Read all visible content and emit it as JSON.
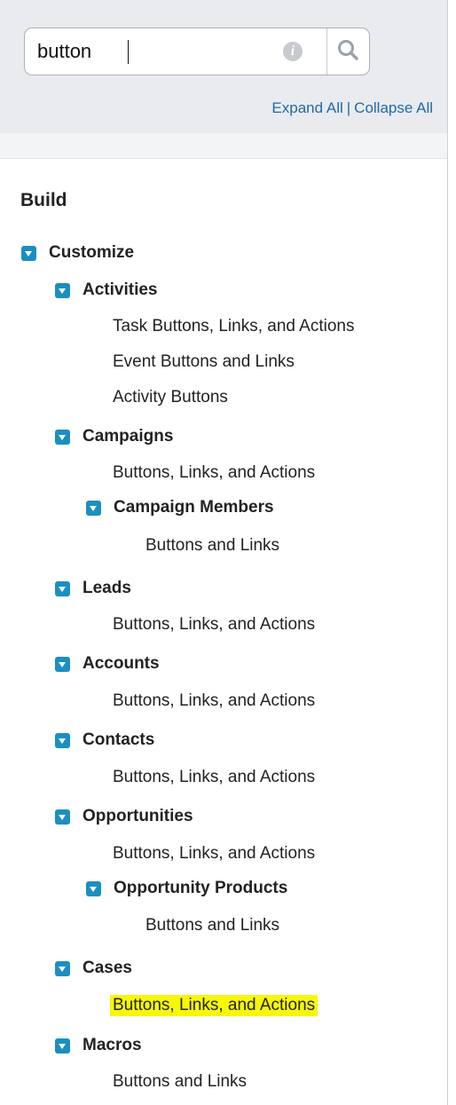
{
  "search": {
    "value": "button",
    "info_icon": "info-icon",
    "button_icon": "search-icon"
  },
  "header": {
    "expand_all": "Expand All",
    "separator": "|",
    "collapse_all": "Collapse All"
  },
  "section_title": "Build",
  "tree": {
    "customize": "Customize",
    "activities": {
      "label": "Activities",
      "task_buttons": "Task Buttons, Links, and Actions",
      "event_buttons": "Event Buttons and Links",
      "activity_buttons": "Activity Buttons"
    },
    "campaigns": {
      "label": "Campaigns",
      "buttons": "Buttons, Links, and Actions",
      "members": {
        "label": "Campaign Members",
        "buttons": "Buttons and Links"
      }
    },
    "leads": {
      "label": "Leads",
      "buttons": "Buttons, Links, and Actions"
    },
    "accounts": {
      "label": "Accounts",
      "buttons": "Buttons, Links, and Actions"
    },
    "contacts": {
      "label": "Contacts",
      "buttons": "Buttons, Links, and Actions"
    },
    "opportunities": {
      "label": "Opportunities",
      "buttons": "Buttons, Links, and Actions",
      "products": {
        "label": "Opportunity Products",
        "buttons": "Buttons and Links"
      }
    },
    "cases": {
      "label": "Cases",
      "buttons": "Buttons, Links, and Actions",
      "highlight_color": "#f7f707"
    },
    "macros": {
      "label": "Macros",
      "buttons": "Buttons and Links"
    }
  },
  "colors": {
    "toggle": "#1b8fc0",
    "link": "#1f6aa8",
    "highlight": "#f7f707"
  }
}
